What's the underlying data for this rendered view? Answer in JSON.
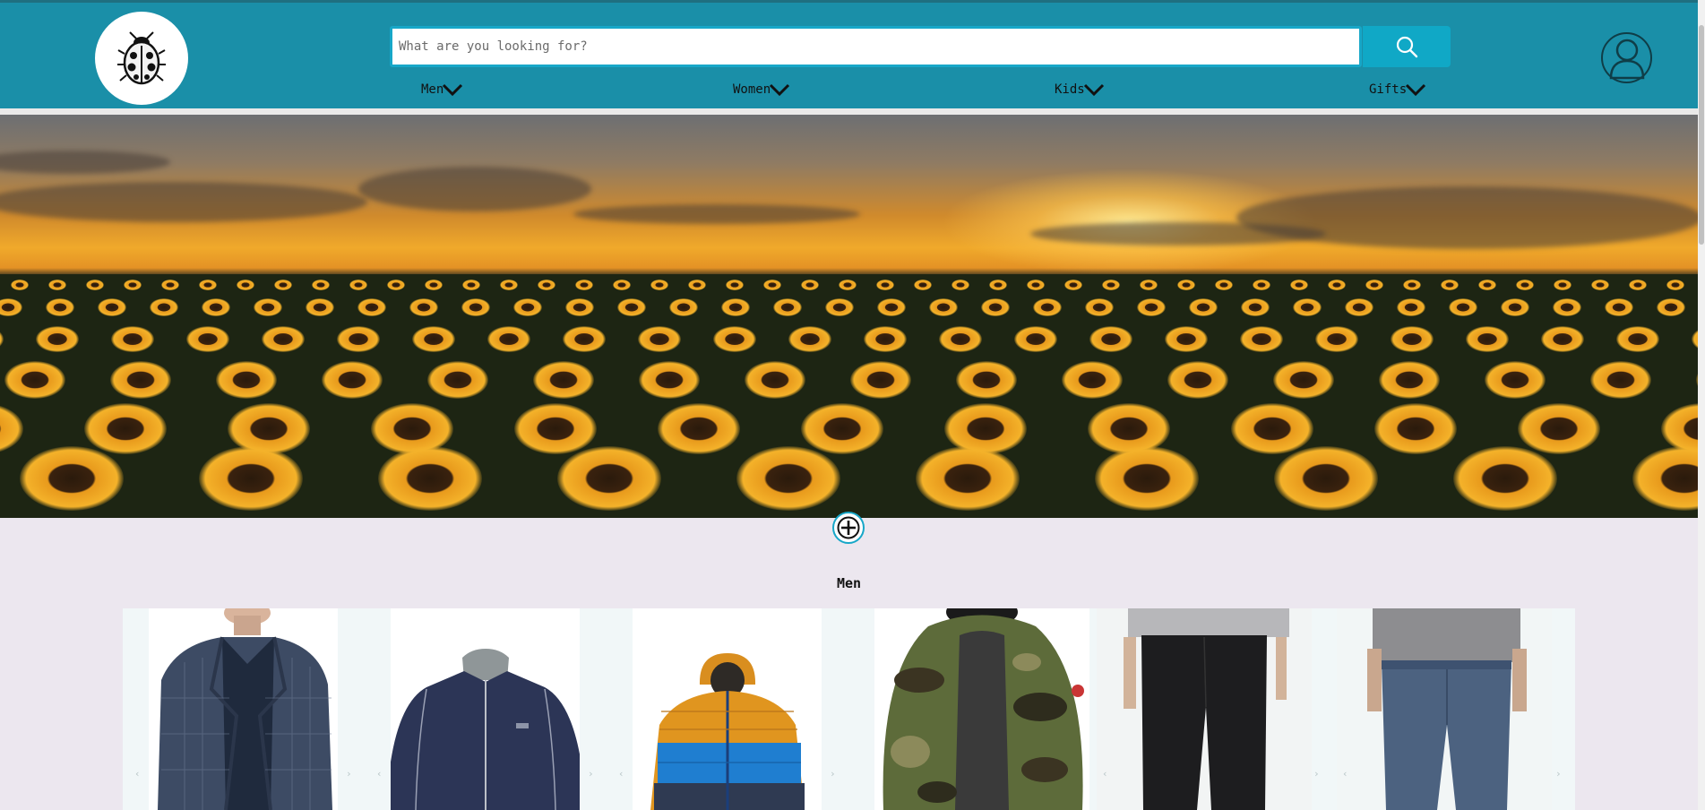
{
  "search": {
    "placeholder": "What are you looking for?"
  },
  "nav": [
    {
      "label": "Men"
    },
    {
      "label": "Women"
    },
    {
      "label": "Kids"
    },
    {
      "label": "Gifts"
    }
  ],
  "section": {
    "title": "Men"
  },
  "products": [
    {
      "name": "plaid-blazer"
    },
    {
      "name": "navy-track-jacket"
    },
    {
      "name": "orange-blue-puffer-jacket"
    },
    {
      "name": "camo-parka"
    },
    {
      "name": "black-jeans"
    },
    {
      "name": "blue-jeans"
    }
  ],
  "colors": {
    "header": "#1a8fa8",
    "accent": "#10a8c6",
    "page_bg": "#ece7ef"
  }
}
